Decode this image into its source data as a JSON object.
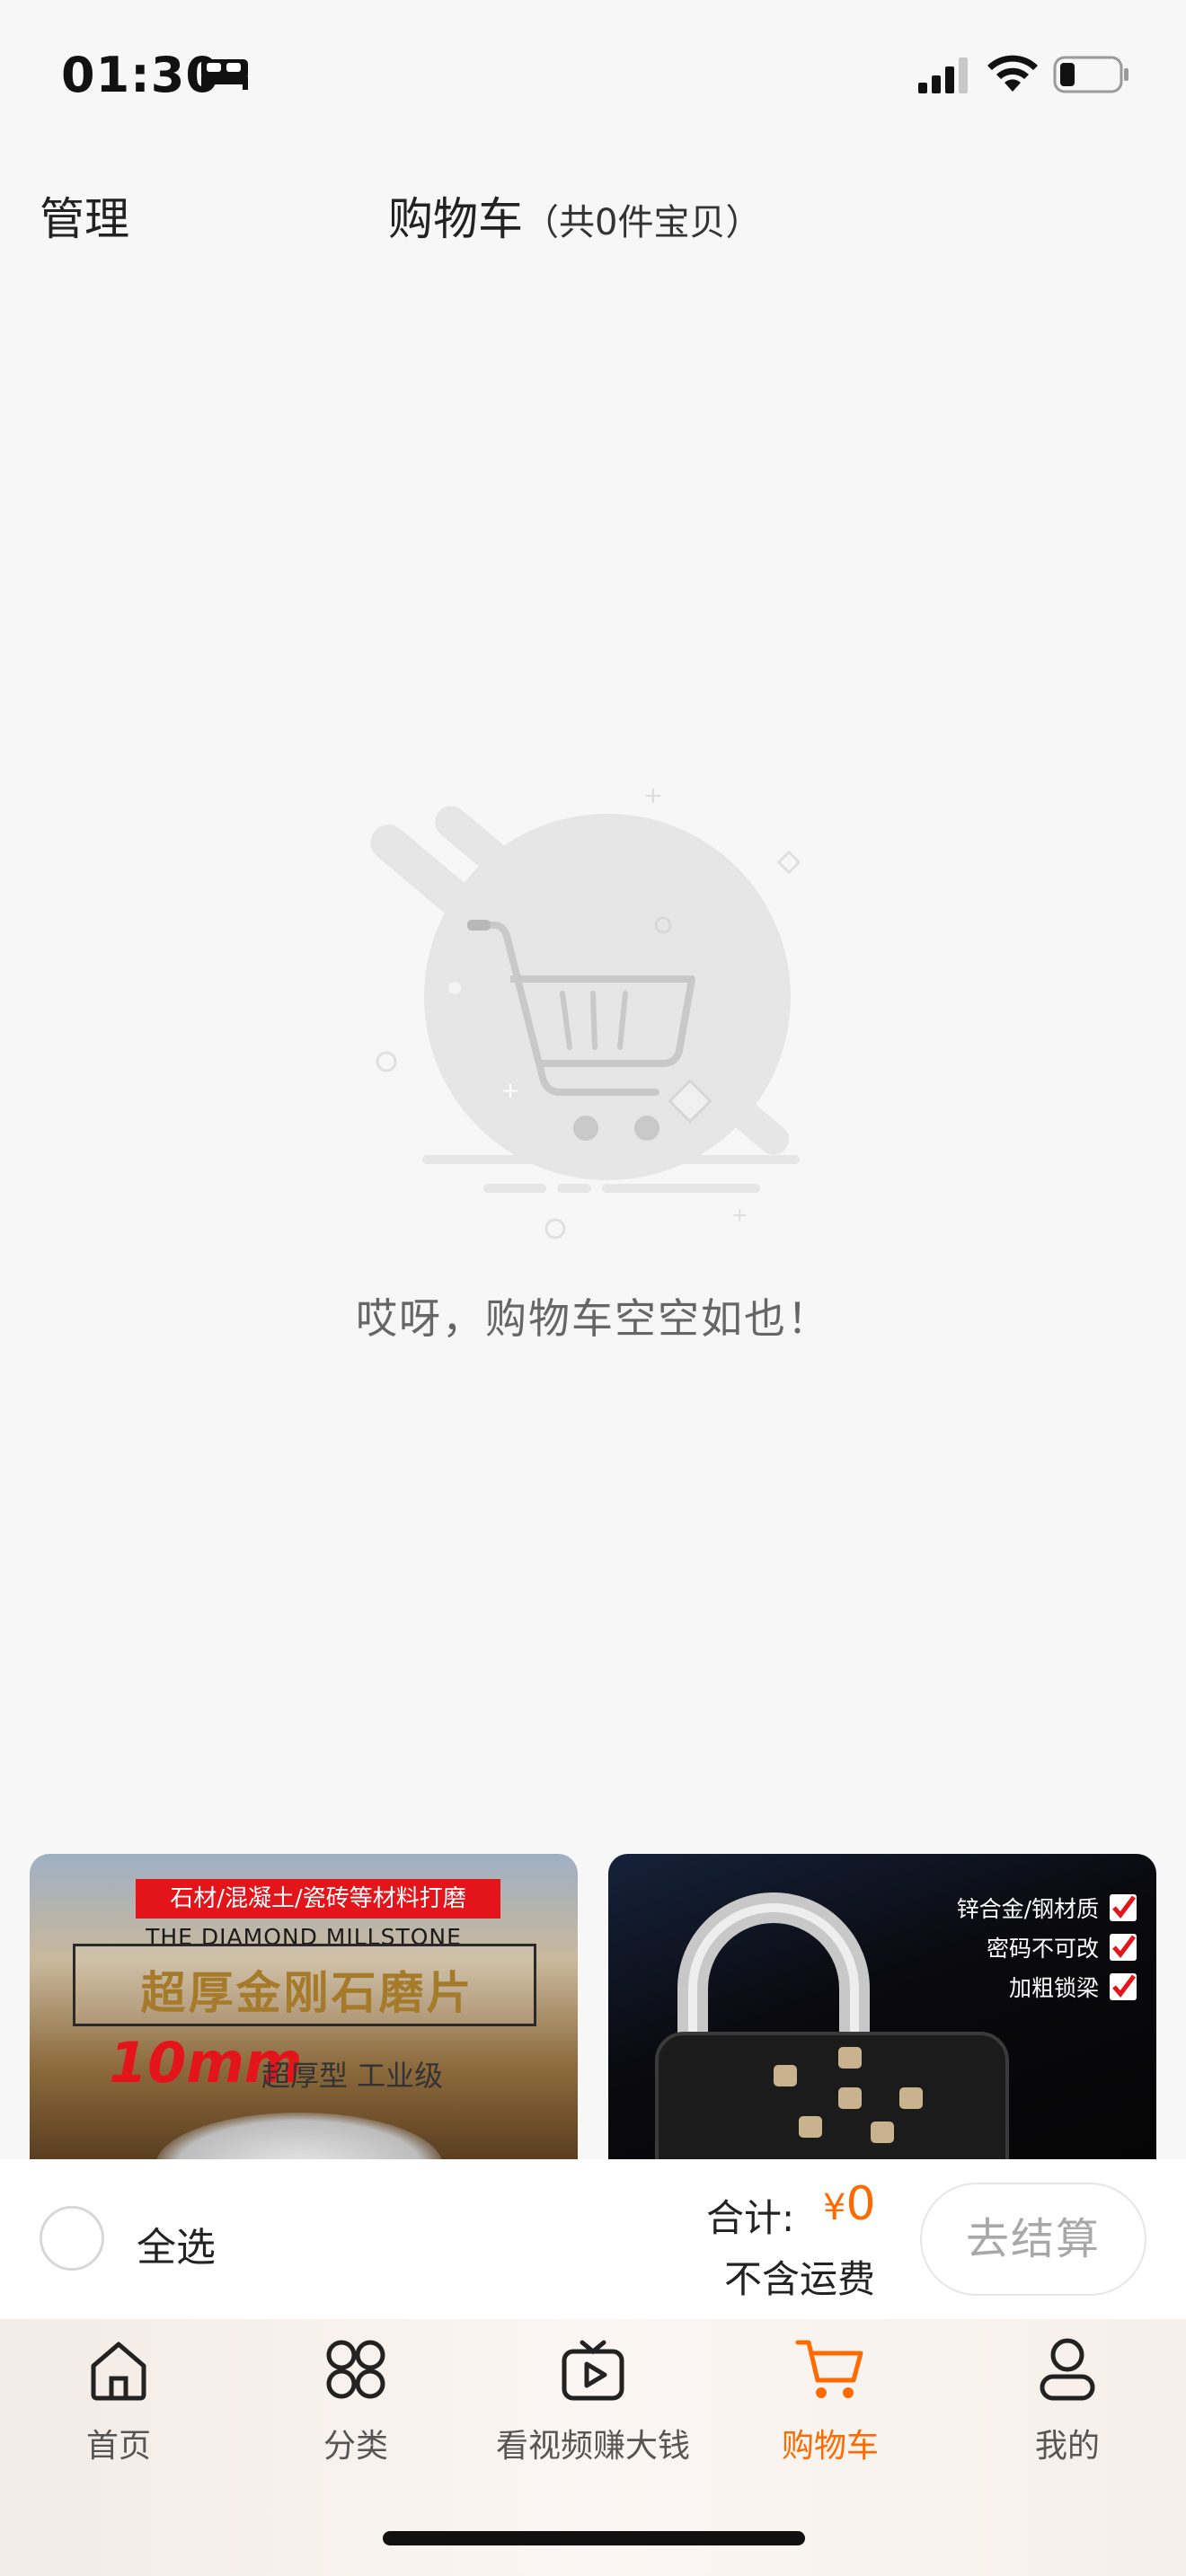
{
  "status_bar": {
    "time": "01:30",
    "icons": [
      "bed-icon",
      "signal-icon",
      "wifi-icon",
      "battery-icon"
    ]
  },
  "header": {
    "manage_label": "管理",
    "title": "购物车",
    "count_text": "（共0件宝贝）"
  },
  "empty_state": {
    "icon": "empty-cart-icon",
    "message": "哎呀，购物车空空如也！"
  },
  "recommended_products": [
    {
      "tag": "石材/混凝土/瓷砖等材料打磨",
      "subtitle": "THE DIAMOND MILLSTONE",
      "headline": "超厚金刚石磨片",
      "size": "10mm",
      "size_note": "超厚型 工业级"
    },
    {
      "features": [
        "锌合金/钢材质",
        "密码不可改",
        "加粗锁梁"
      ]
    }
  ],
  "cart_bar": {
    "select_all_label": "全选",
    "total_label": "合计:",
    "currency": "¥",
    "total_value": "0",
    "shipping_note": "不含运费",
    "checkout_label": "去结算"
  },
  "tab_bar": {
    "tabs": [
      {
        "label": "首页",
        "icon": "home-icon",
        "active": false
      },
      {
        "label": "分类",
        "icon": "category-icon",
        "active": false
      },
      {
        "label": "看视频赚大钱",
        "icon": "video-icon",
        "active": false
      },
      {
        "label": "购物车",
        "icon": "cart-icon",
        "active": true
      },
      {
        "label": "我的",
        "icon": "profile-icon",
        "active": false
      }
    ]
  },
  "colors": {
    "accent": "#ff6a00",
    "background": "#f7f7f7",
    "price_red": "#e4141b"
  }
}
